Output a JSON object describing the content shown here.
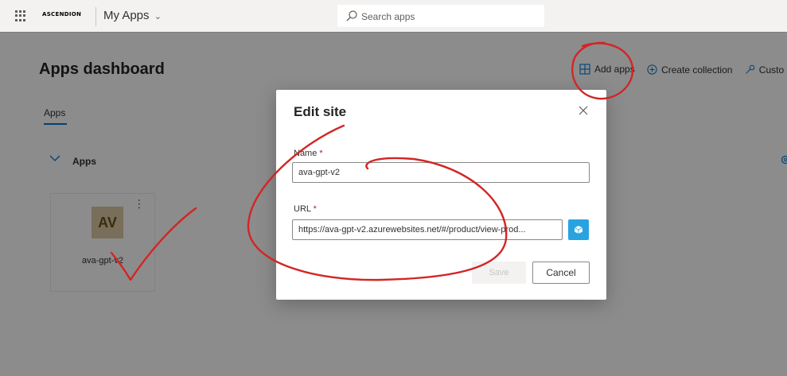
{
  "topbar": {
    "logo_text": "ASCENDION",
    "app_name": "My Apps",
    "search_placeholder": "Search apps"
  },
  "page": {
    "title": "Apps dashboard"
  },
  "actions": {
    "add_apps": "Add apps",
    "create_collection": "Create collection",
    "customize": "Custo"
  },
  "tabs": {
    "apps": "Apps"
  },
  "section": {
    "title": "Apps"
  },
  "tile": {
    "initials": "AV",
    "name": "ava-gpt-v2",
    "avatar_color": "#ddc9a3"
  },
  "dialog": {
    "title": "Edit site",
    "name_label": "Name",
    "name_value": "ava-gpt-v2",
    "url_label": "URL",
    "url_value": "https://ava-gpt-v2.azurewebsites.net/#/product/view-prod...",
    "required_marker": "*",
    "save_label": "Save",
    "cancel_label": "Cancel"
  },
  "colors": {
    "accent": "#0078d4",
    "annotation": "#d32525",
    "url_button": "#29a3e0"
  }
}
